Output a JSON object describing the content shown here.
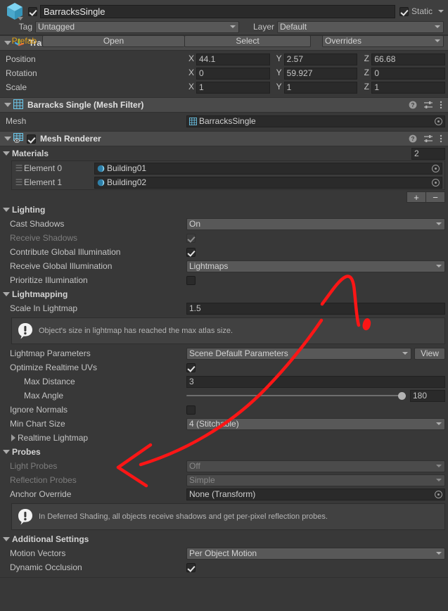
{
  "gameobject": {
    "icon": "cube-icon",
    "enabled_checkbox": true,
    "name": "BarracksSingle",
    "static_checked": true,
    "static_label": "Static",
    "tag_label": "Tag",
    "tag_value": "Untagged",
    "layer_label": "Layer",
    "layer_value": "Default",
    "prefab_label": "Prefab",
    "prefab_open": "Open",
    "prefab_select": "Select",
    "prefab_overrides": "Overrides"
  },
  "transform": {
    "title": "Transform",
    "icon": "transform-axis-icon",
    "rows": [
      {
        "label": "Position",
        "x": "44.1",
        "y": "2.57",
        "z": "66.68"
      },
      {
        "label": "Rotation",
        "x": "0",
        "y": "59.927",
        "z": "0"
      },
      {
        "label": "Scale",
        "x": "1",
        "y": "1",
        "z": "1"
      }
    ],
    "axis_x": "X",
    "axis_y": "Y",
    "axis_z": "Z"
  },
  "mesh_filter": {
    "title": "Barracks Single (Mesh Filter)",
    "icon": "mesh-filter-icon",
    "mesh_label": "Mesh",
    "mesh_value": "BarracksSingle"
  },
  "mesh_renderer": {
    "title": "Mesh Renderer",
    "icon": "mesh-renderer-icon",
    "enabled": true,
    "materials": {
      "title": "Materials",
      "size": "2",
      "elements": [
        {
          "label": "Element 0",
          "value": "Building01"
        },
        {
          "label": "Element 1",
          "value": "Building02"
        }
      ],
      "add_label": "+",
      "remove_label": "−"
    },
    "lighting": {
      "title": "Lighting",
      "cast_shadows_label": "Cast Shadows",
      "cast_shadows_value": "On",
      "receive_shadows_label": "Receive Shadows",
      "receive_shadows_checked": true,
      "receive_shadows_disabled": true,
      "contribute_gi_label": "Contribute Global Illumination",
      "contribute_gi_checked": true,
      "receive_gi_label": "Receive Global Illumination",
      "receive_gi_value": "Lightmaps",
      "prioritize_label": "Prioritize Illumination",
      "prioritize_checked": false
    },
    "lightmapping": {
      "title": "Lightmapping",
      "scale_label": "Scale In Lightmap",
      "scale_value": "1.5",
      "warning": "Object's size in lightmap has reached the max atlas size.",
      "params_label": "Lightmap Parameters",
      "params_value": "Scene Default Parameters",
      "params_view_button": "View",
      "optimize_uvs_label": "Optimize Realtime UVs",
      "optimize_uvs_checked": true,
      "max_distance_label": "Max Distance",
      "max_distance_value": "3",
      "max_angle_label": "Max Angle",
      "max_angle_value": "180",
      "max_angle_fill_percent": 100,
      "ignore_normals_label": "Ignore Normals",
      "ignore_normals_checked": false,
      "min_chart_label": "Min Chart Size",
      "min_chart_value": "4 (Stitchable)",
      "realtime_lightmap_label": "Realtime Lightmap"
    },
    "probes": {
      "title": "Probes",
      "light_probes_label": "Light Probes",
      "light_probes_value": "Off",
      "light_probes_disabled": true,
      "reflection_probes_label": "Reflection Probes",
      "reflection_probes_value": "Simple",
      "reflection_probes_disabled": true,
      "anchor_label": "Anchor Override",
      "anchor_value": "None (Transform)",
      "info": "In Deferred Shading, all objects receive shadows and get per-pixel reflection probes."
    },
    "additional": {
      "title": "Additional Settings",
      "motion_vectors_label": "Motion Vectors",
      "motion_vectors_value": "Per Object Motion",
      "dynamic_occlusion_label": "Dynamic Occlusion",
      "dynamic_occlusion_checked": true
    }
  },
  "annotation": {
    "color": "#fb1616"
  },
  "colors": {
    "background": "#383838",
    "header": "#3f3f3f",
    "component_header": "#4a4a4a",
    "field": "#2a2a2a",
    "popup": "#585858",
    "prefab_accent": "#e3a317",
    "icon_blue": "#6bc5e8"
  }
}
